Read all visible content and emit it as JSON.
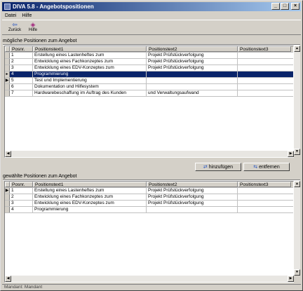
{
  "window": {
    "title": "DIVA 5.8 - Angebotspositionen"
  },
  "menu": {
    "items": [
      "Datei",
      "Hilfe"
    ]
  },
  "toolbar": {
    "back_label": "Zurück",
    "help_label": "Hilfe"
  },
  "possible": {
    "section_label": "mögliche Positionen zum Angebot",
    "columns": [
      "Posnr.",
      "Positionstext1",
      "Positionstext2",
      "Positionstext3"
    ],
    "rows": [
      {
        "ind": "",
        "posnr": "1",
        "t1": "Erstellung eines Lastenheftes zum",
        "t2": "Projekt Prüfstückverfolgung",
        "t3": ""
      },
      {
        "ind": "",
        "posnr": "2",
        "t1": "Entwicklung eines Fachkonzeptes zum",
        "t2": "Projekt Prüfstückverfolgung",
        "t3": ""
      },
      {
        "ind": "",
        "posnr": "3",
        "t1": "Entwicklung eines EDV-Konzeptes zum",
        "t2": "Projekt Prüfstückverfolgung",
        "t3": ""
      },
      {
        "ind": "▸",
        "posnr": "4",
        "t1": "Programmierung",
        "t2": "",
        "t3": ""
      },
      {
        "ind": "▶",
        "posnr": "5",
        "t1": "Test und Implementierung",
        "t2": "",
        "t3": ""
      },
      {
        "ind": "",
        "posnr": "6",
        "t1": "Dokumentation und Hilfesystem",
        "t2": "",
        "t3": ""
      },
      {
        "ind": "",
        "posnr": "7",
        "t1": "Hardwarebeschaffung im Auftrag des Kunden",
        "t2": "und Verwaltungsaufwand",
        "t3": ""
      }
    ],
    "selected_index": 3
  },
  "actions": {
    "add_label": "hinzufügen",
    "remove_label": "entfernen"
  },
  "chosen": {
    "section_label": "gewählte Positionen zum Angebot",
    "columns": [
      "Posnr.",
      "Positionstext1",
      "Positionstext2",
      "Positionstext3"
    ],
    "rows": [
      {
        "ind": "▶",
        "posnr": "1",
        "t1": "Erstellung eines Lastenheftes zum",
        "t2": "Projekt Prüfstückverfolgung",
        "t3": ""
      },
      {
        "ind": "",
        "posnr": "2",
        "t1": "Entwicklung eines Fachkonzeptes zum",
        "t2": "Projekt Prüfstückverfolgung",
        "t3": ""
      },
      {
        "ind": "",
        "posnr": "3",
        "t1": "Entwicklung eines EDV-Konzeptes zum",
        "t2": "Projekt Prüfstückverfolgung",
        "t3": ""
      },
      {
        "ind": "",
        "posnr": "4",
        "t1": "Programmierung",
        "t2": "",
        "t3": ""
      }
    ]
  },
  "status": {
    "text": "Mandant: Mandant"
  },
  "colors": {
    "selection": "#0a246a",
    "title_start": "#0a246a",
    "title_end": "#a6caf0"
  }
}
